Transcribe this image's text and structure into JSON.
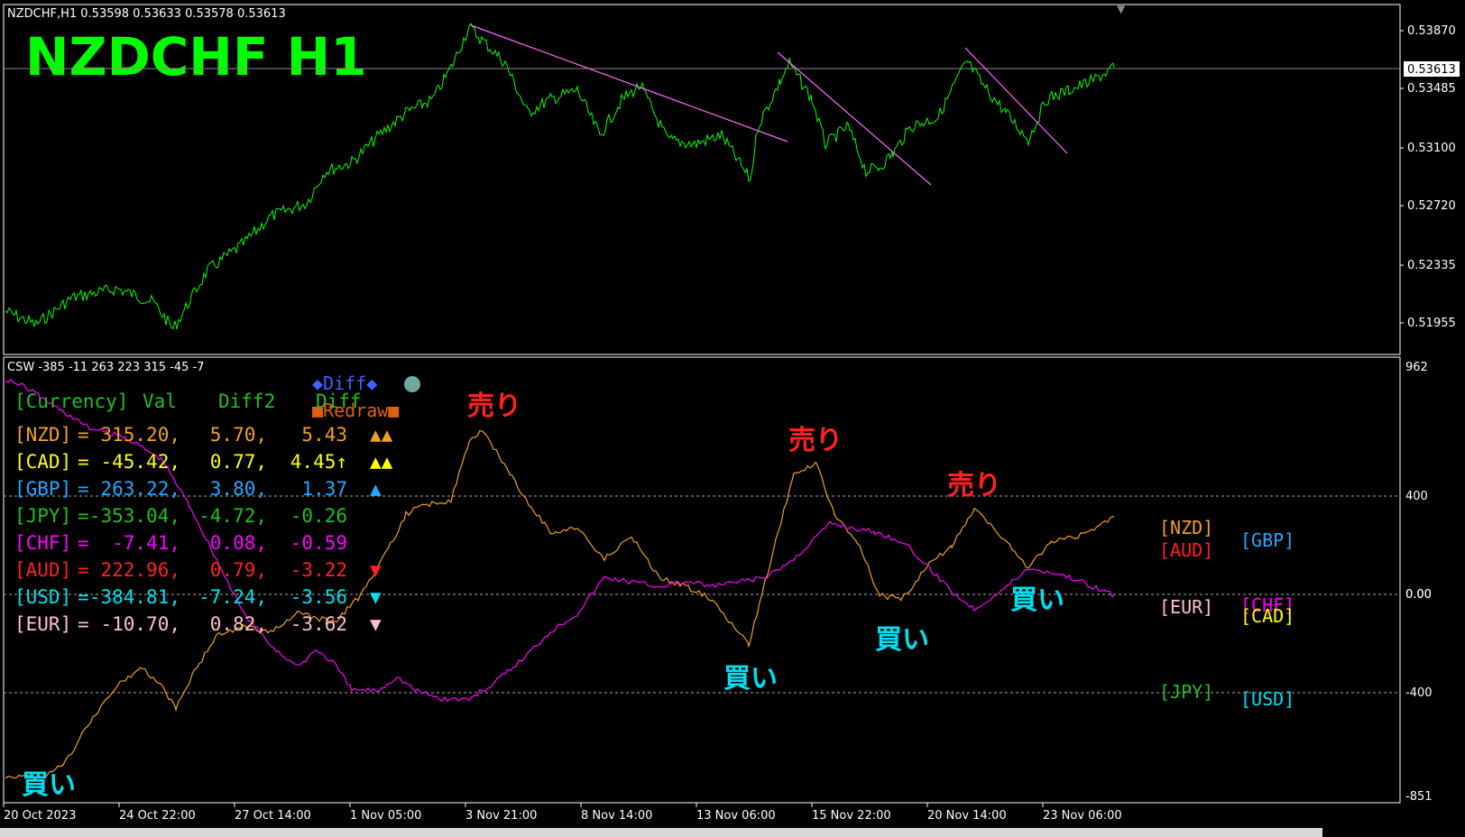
{
  "window": {
    "title": "NZDCHF,H1  0.53598 0.53633 0.53578 0.53613",
    "big_label": "NZDCHF  H1",
    "menu_arrow": "▼"
  },
  "price_axis": {
    "labels": [
      "0.53870",
      "0.53485",
      "0.53100",
      "0.52720",
      "0.52335",
      "0.51955"
    ],
    "current": "0.53613"
  },
  "indicator": {
    "title": "CSW -385 -11 263 223 315 -45 -7",
    "axis_labels": [
      "962",
      "400",
      "0.00",
      "0.00",
      "-400",
      "-851"
    ],
    "table_header": {
      "currency": "[Currency]",
      "val": "Val",
      "diff2": "Diff2",
      "diff": "Diff"
    },
    "diff_button": "◆Diff◆",
    "redraw_button": "■Redraw■",
    "rows": [
      {
        "code": "[NZD]",
        "eq": "=",
        "val": "315.20,",
        "diff2": "5.70,",
        "diff": "5.43",
        "arrows": "▲▲",
        "color": "#f0a020"
      },
      {
        "code": "[CAD]",
        "eq": "=",
        "val": "-45.42,",
        "diff2": "0.77,",
        "diff": "4.45↑",
        "arrows": "▲▲",
        "color": "#ffff00"
      },
      {
        "code": "[GBP]",
        "eq": "=",
        "val": "263.22,",
        "diff2": "3.80,",
        "diff": "1.37",
        "arrows": "▲",
        "color": "#20a8ff"
      },
      {
        "code": "[JPY]",
        "eq": "=",
        "val": "-353.04,",
        "diff2": "-4.72,",
        "diff": "-0.26",
        "arrows": "",
        "color": "#20c020"
      },
      {
        "code": "[CHF]",
        "eq": "=",
        "val": "-7.41,",
        "diff2": "0.08,",
        "diff": "-0.59",
        "arrows": "",
        "color": "#ff00ff"
      },
      {
        "code": "[AUD]",
        "eq": "=",
        "val": "222.96,",
        "diff2": "0.79,",
        "diff": "-3.22",
        "arrows": "▼",
        "color": "#ff2020"
      },
      {
        "code": "[USD]",
        "eq": "=",
        "val": "-384.81,",
        "diff2": "-7.24,",
        "diff": "-3.56",
        "arrows": "▼",
        "color": "#00e0f0"
      },
      {
        "code": "[EUR]",
        "eq": "=",
        "val": "-10.70,",
        "diff2": "0.82,",
        "diff": "-3.62",
        "arrows": "▼",
        "color": "#ffc0c8"
      }
    ],
    "right_labels": {
      "nzd": "[NZD]",
      "aud": "[AUD]",
      "gbp": "[GBP]",
      "eur": "[EUR]",
      "chf": "[CHF]",
      "cad": "[CAD]",
      "jpy": "[JPY]",
      "usd": "[USD]"
    },
    "annotations": {
      "sell": "売り",
      "buy": "買い"
    }
  },
  "time_axis": {
    "labels": [
      "20 Oct 2023",
      "24 Oct 22:00",
      "27 Oct 14:00",
      "1 Nov 05:00",
      "3 Nov 21:00",
      "8 Nov 14:00",
      "13 Nov 06:00",
      "15 Nov 22:00",
      "20 Nov 14:00",
      "23 Nov 06:00"
    ]
  },
  "colors": {
    "price_line": "#00ff00",
    "trend_line": "#ff00ff",
    "nzd": "#f0a020",
    "chf": "#ff00ff",
    "sell": "#ff2020",
    "buy": "#00e0f0",
    "big_label": "#00ff00"
  }
}
